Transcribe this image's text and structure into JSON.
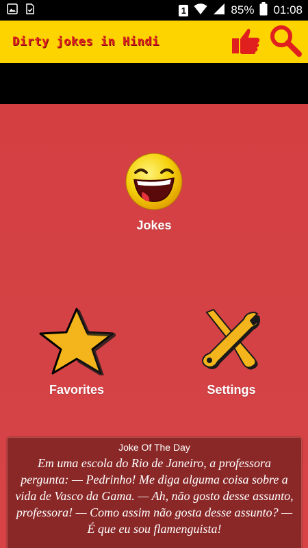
{
  "status_bar": {
    "sim_badge": "1",
    "battery_percent": "85%",
    "time": "01:08"
  },
  "app_bar": {
    "title": "Dirty jokes in Hindi",
    "icons": [
      "thumbs-up-icon",
      "search-icon"
    ],
    "accent_color": "#fdd300",
    "title_color": "#e0201e"
  },
  "menu": {
    "jokes": {
      "label": "Jokes",
      "icon": "laughing-face-icon"
    },
    "favorites": {
      "label": "Favorites",
      "icon": "star-icon"
    },
    "settings": {
      "label": "Settings",
      "icon": "tools-icon"
    }
  },
  "joke_of_the_day": {
    "title": "Joke Of The Day",
    "text": "Em uma escola do Rio de Janeiro, a professora pergunta: — Pedrinho! Me diga alguma coisa sobre a vida de Vasco da Gama. — Ah, não gosto desse assunto, professora! — Como assim não gosta desse assunto? — É que eu sou flamenguista!"
  },
  "colors": {
    "background": "#d64043",
    "icon_gold": "#f3b51b"
  }
}
